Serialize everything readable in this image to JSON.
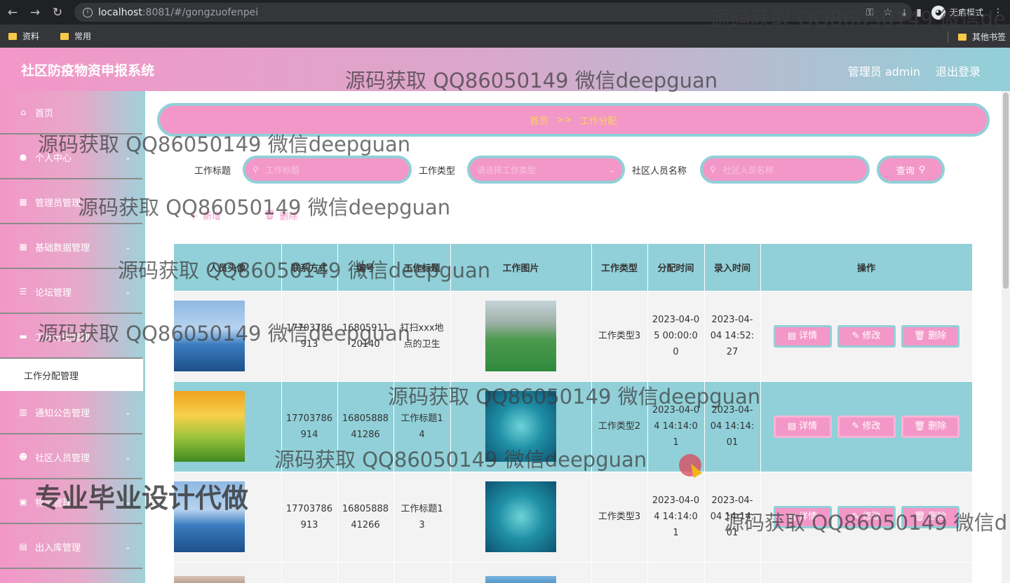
{
  "browser": {
    "url_host": "localhost",
    "url_port_path": ":8081/#/gongzuofenpei",
    "profile_label": "无痕模式",
    "bookmarks": [
      "资料",
      "常用"
    ],
    "other_bookmarks": "其他书签"
  },
  "header": {
    "title": "社区防疫物资申报系统",
    "user": "管理员 admin",
    "logout": "退出登录"
  },
  "sidebar": {
    "items": [
      {
        "label": "首页",
        "icon": "home-icon"
      },
      {
        "label": "个人中心",
        "icon": "user-icon"
      },
      {
        "label": "管理员管理",
        "icon": "grid-icon"
      },
      {
        "label": "基础数据管理",
        "icon": "grid-icon"
      },
      {
        "label": "论坛管理",
        "icon": "sliders-icon"
      },
      {
        "label": "工作分配管理",
        "icon": "monitor-icon"
      },
      {
        "label": "通知公告管理",
        "icon": "bar-chart-icon"
      },
      {
        "label": "社区人员管理",
        "icon": "users-icon"
      },
      {
        "label": "物资管理",
        "icon": "image-icon"
      },
      {
        "label": "出入库管理",
        "icon": "clipboard-icon"
      }
    ],
    "active_sub": "工作分配管理"
  },
  "breadcrumb": {
    "home": "首页",
    "separator": ">>",
    "current": "工作分配"
  },
  "search": {
    "title_label": "工作标题",
    "title_placeholder": "工作标题",
    "type_label": "工作类型",
    "type_placeholder": "请选择工作类型",
    "person_label": "社区人员名称",
    "person_placeholder": "社区人员名称",
    "query_button": "查询"
  },
  "actions": {
    "add": "新增",
    "delete": "删除"
  },
  "table": {
    "columns": [
      "人员头像",
      "联系方式",
      "编号",
      "工作标题",
      "工作图片",
      "工作类型",
      "分配时间",
      "录入时间",
      "操作"
    ],
    "rows": [
      {
        "phone": "17703786913",
        "code": "1680591120140",
        "title": "打扫xxx地点的卫生",
        "type": "工作类型3",
        "assign_time": "2023-04-05 00:00:00",
        "entry_time": "2023-04-04 14:52:27"
      },
      {
        "phone": "17703786914",
        "code": "1680588841286",
        "title": "工作标题14",
        "type": "工作类型2",
        "assign_time": "2023-04-04 14:14:01",
        "entry_time": "2023-04-04 14:14:01"
      },
      {
        "phone": "17703786913",
        "code": "1680588841266",
        "title": "工作标题13",
        "type": "工作类型3",
        "assign_time": "2023-04-04 14:14:01",
        "entry_time": "2023-04-04 14:14:01"
      }
    ],
    "op_detail": "详情",
    "op_edit": "修改",
    "op_delete": "删除"
  },
  "overlay": {
    "watermark": "源码获取 QQ86050149 微信deepguan",
    "watermark_cut1": "源码获取 QQ86050149 微信de",
    "watermark_cut2": "源码获取 QQ86050149 微信d",
    "promo": "专业毕业设计代做"
  },
  "colors": {
    "pink": "#f397c8",
    "teal": "#91d0d8",
    "breadcrumb_text": "#f7d850"
  }
}
